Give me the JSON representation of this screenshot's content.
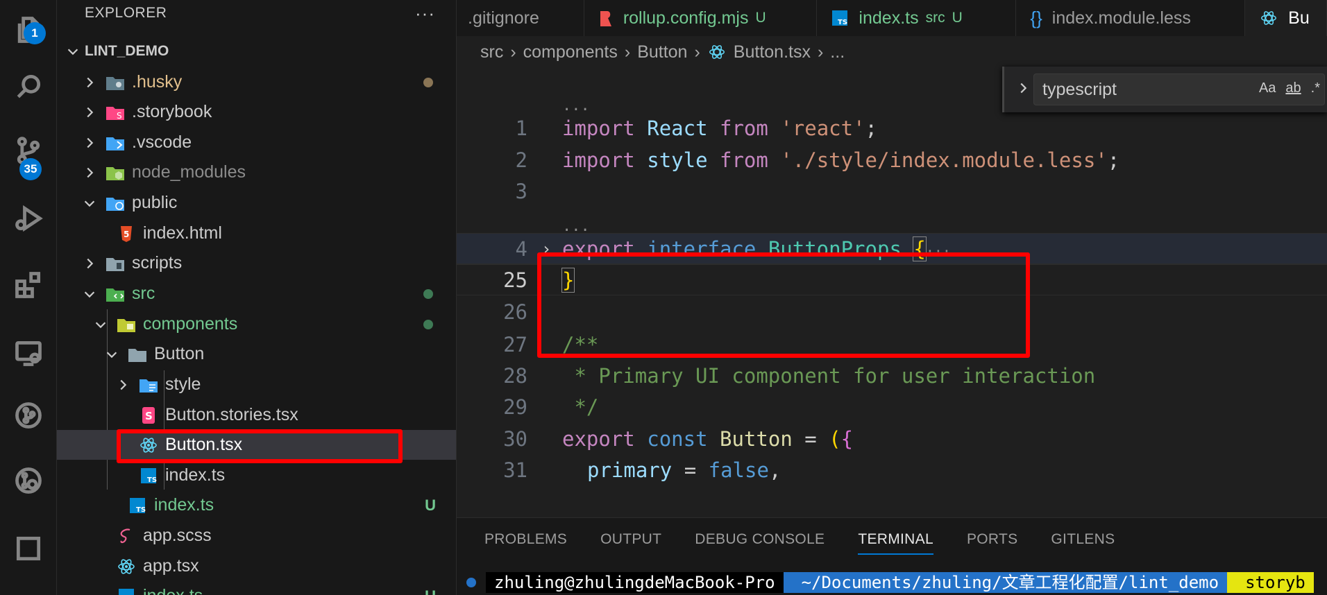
{
  "activity_bar": {
    "explorer_badge": "1",
    "scm_badge": "35"
  },
  "sidebar": {
    "header": "EXPLORER",
    "more": "···",
    "root": "LINT_DEMO",
    "items": [
      {
        "label": ".husky"
      },
      {
        "label": ".storybook"
      },
      {
        "label": ".vscode"
      },
      {
        "label": "node_modules"
      },
      {
        "label": "public"
      },
      {
        "label": "index.html"
      },
      {
        "label": "scripts"
      },
      {
        "label": "src"
      },
      {
        "label": "components"
      },
      {
        "label": "Button"
      },
      {
        "label": "style"
      },
      {
        "label": "Button.stories.tsx"
      },
      {
        "label": "Button.tsx"
      },
      {
        "label": "index.ts"
      },
      {
        "label": "index.ts",
        "status": "U"
      },
      {
        "label": "app.scss"
      },
      {
        "label": "app.tsx"
      },
      {
        "label": "index.ts",
        "status": "U"
      }
    ]
  },
  "tabs": [
    {
      "label": ".gitignore"
    },
    {
      "label": "rollup.config.mjs",
      "status": "U"
    },
    {
      "label": "index.ts",
      "detail": "src",
      "status": "U"
    },
    {
      "label": "index.module.less"
    },
    {
      "label": "Bu"
    }
  ],
  "breadcrumb": [
    "src",
    "components",
    "Button",
    "Button.tsx",
    "..."
  ],
  "find": {
    "value": "typescript",
    "opt_case": "Aa",
    "opt_word": "ab",
    "opt_regex": ".*"
  },
  "editor": {
    "fold_marker": "...",
    "line_numbers": [
      "1",
      "2",
      "3",
      "4",
      "25",
      "26",
      "27",
      "28",
      "29",
      "30",
      "31"
    ],
    "l1": {
      "kw": "import",
      "id": "React",
      "from": "from",
      "str": "'react'",
      "end": ";"
    },
    "l2": {
      "kw": "import",
      "id": "style",
      "from": "from",
      "str": "'./style/index.module.less'",
      "end": ";"
    },
    "l4": {
      "kw": "export",
      "kw2": "interface",
      "ty": "ButtonProps",
      "br": "{",
      "ell": "···"
    },
    "l25": {
      "br": "}"
    },
    "l27": "/**",
    "l28": " * Primary UI component for user interaction",
    "l29": " */",
    "l30": {
      "kw": "export",
      "kw2": "const",
      "fn": "Button",
      "op": "=",
      "br": "(",
      "br2": "{"
    },
    "l31": {
      "id": "primary",
      "op": "=",
      "val": "false",
      "end": ","
    }
  },
  "panel": {
    "tabs": [
      "PROBLEMS",
      "OUTPUT",
      "DEBUG CONSOLE",
      "TERMINAL",
      "PORTS",
      "GITLENS"
    ],
    "active_tab": "TERMINAL",
    "terminal": {
      "user": "zhuling@zhulingdeMacBook-Pro",
      "path": "~/Documents/zhuling/文章工程化配置/lint_demo",
      "git": " storyb"
    }
  },
  "colors": {
    "highlight": "#ff0000",
    "accent": "#0078d4",
    "untracked": "#73c991"
  }
}
